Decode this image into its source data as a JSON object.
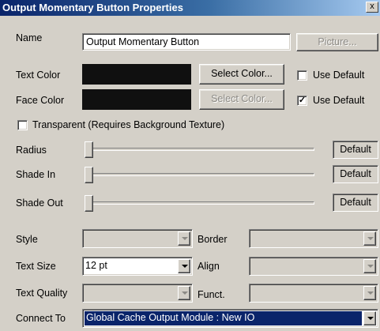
{
  "window": {
    "title": "Output Momentary Button Properties",
    "close_glyph": "x"
  },
  "name": {
    "label": "Name",
    "value": "Output Momentary Button",
    "picture_button": "Picture..."
  },
  "text_color": {
    "label": "Text Color",
    "swatch": "#101010",
    "select_button": "Select Color...",
    "use_default_label": "Use Default",
    "use_default_checked": false
  },
  "face_color": {
    "label": "Face Color",
    "swatch": "#101010",
    "select_button": "Select Color...",
    "use_default_label": "Use Default",
    "use_default_checked": true,
    "check_glyph": "✓"
  },
  "transparent": {
    "label": "Transparent (Requires Background Texture)",
    "checked": false
  },
  "sliders": {
    "radius": {
      "label": "Radius",
      "button": "Default",
      "level": 0
    },
    "shade_in": {
      "label": "Shade In",
      "button": "Default",
      "level": 0
    },
    "shade_out": {
      "label": "Shade Out",
      "button": "Default",
      "level": 0
    }
  },
  "style": {
    "label": "Style",
    "value": ""
  },
  "border": {
    "label": "Border",
    "value": ""
  },
  "text_size": {
    "label": "Text Size",
    "value": "12 pt"
  },
  "align": {
    "label": "Align",
    "value": ""
  },
  "text_quality": {
    "label": "Text Quality",
    "value": ""
  },
  "funct": {
    "label": "Funct.",
    "value": ""
  },
  "connect_to": {
    "label": "Connect To",
    "value": "Global Cache Output Module : New IO"
  },
  "colors": {
    "selection": "#0a246a",
    "title_start": "#0a246a",
    "title_end": "#a6caf0"
  }
}
